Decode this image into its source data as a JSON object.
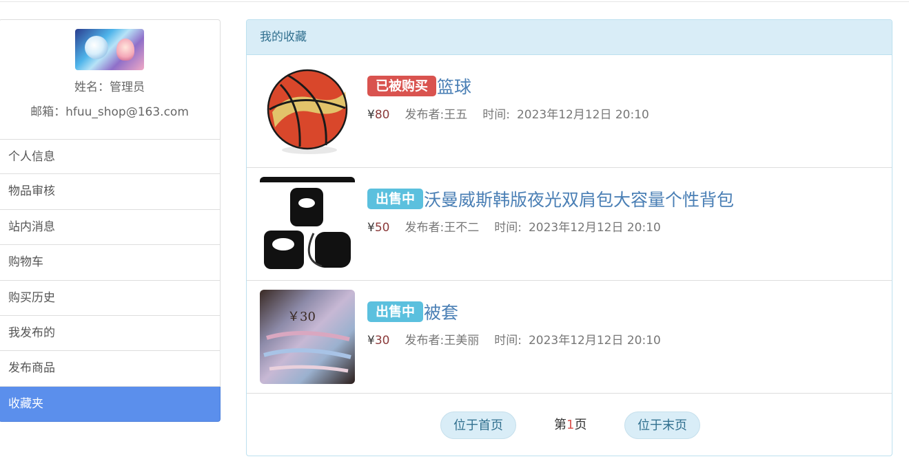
{
  "sidebar": {
    "name_line": "姓名：管理员",
    "email_line": "邮箱：hfuu_shop@163.com",
    "menu": [
      "个人信息",
      "物品审核",
      "站内消息",
      "购物车",
      "购买历史",
      "我发布的",
      "发布商品",
      "收藏夹"
    ],
    "active_index": 7
  },
  "panel": {
    "heading": "我的收藏",
    "items": [
      {
        "badge": "已被购买",
        "badge_type": "sold",
        "title": "篮球",
        "currency": "¥",
        "price": "80",
        "publisher": "发布者:王五",
        "time_label": "时间:",
        "time": "2023年12月12日 20:10",
        "image": "basketball"
      },
      {
        "badge": "出售中",
        "badge_type": "onsale",
        "title": "沃曼威斯韩版夜光双肩包大容量个性背包",
        "currency": "¥",
        "price": "50",
        "publisher": "发布者:王不二",
        "time_label": "时间:",
        "time": "2023年12月12日 20:10",
        "image": "backpack"
      },
      {
        "badge": "出售中",
        "badge_type": "onsale",
        "title": "被套",
        "currency": "¥",
        "price": "30",
        "publisher": "发布者:王美丽",
        "time_label": "时间:",
        "time": "2023年12月12日 20:10",
        "image": "quilt",
        "image_text": "￥30"
      }
    ]
  },
  "pager": {
    "first_label": "位于首页",
    "page_prefix": "第",
    "page_num": "1",
    "page_suffix": "页",
    "last_label": "位于末页"
  },
  "colors": {
    "accent": "#5b8fec",
    "sold": "#d9534f",
    "onsale": "#5bc0de",
    "heading_bg": "#d9edf7"
  }
}
